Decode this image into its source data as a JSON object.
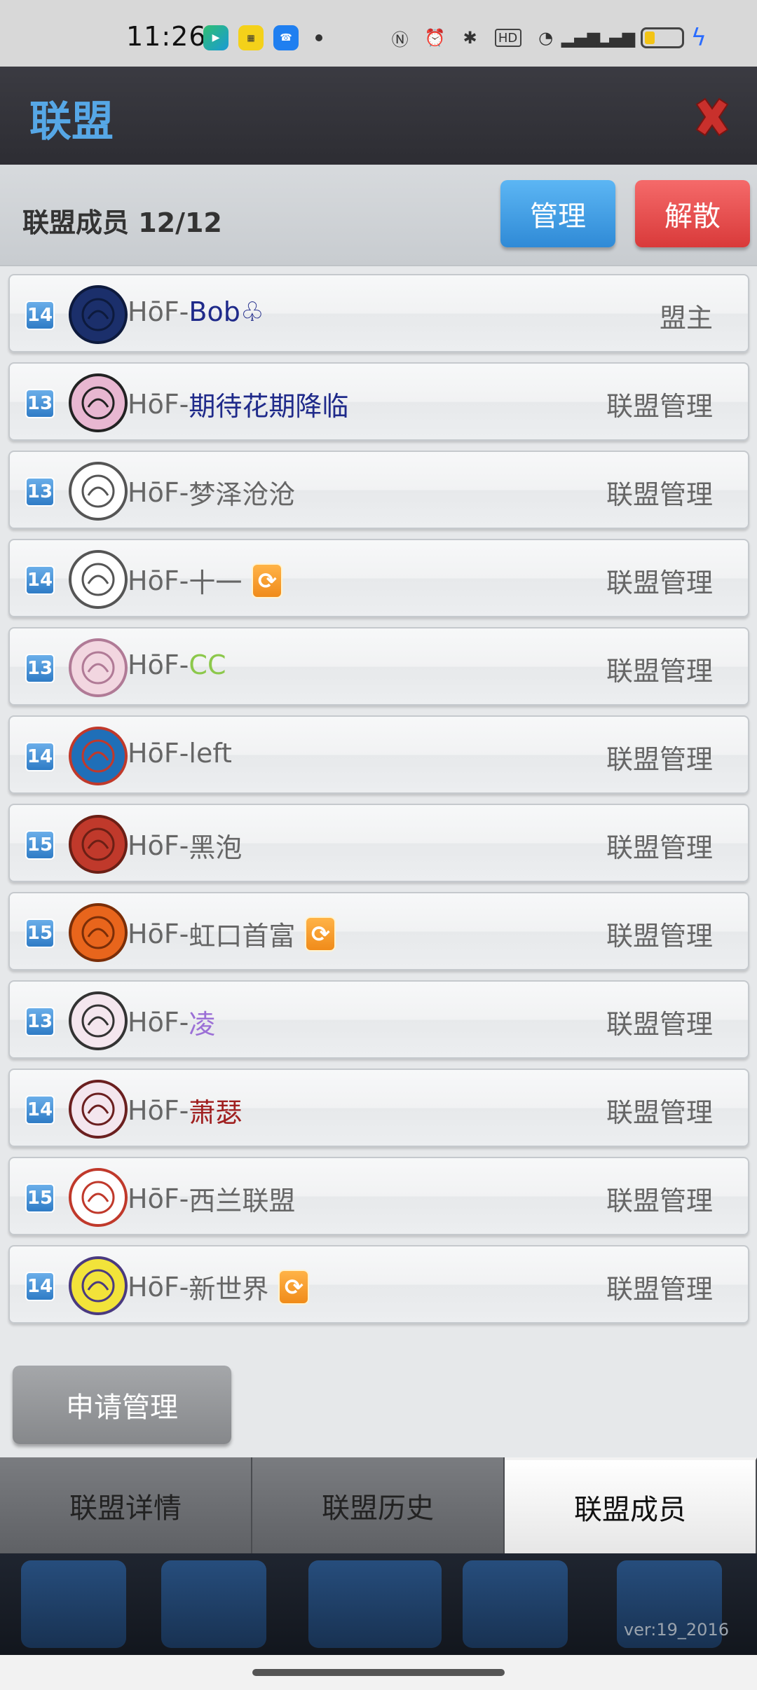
{
  "status_bar": {
    "time": "11:26",
    "icons": [
      "nfc-icon",
      "alarm-icon",
      "bluetooth-icon",
      "hd-icon",
      "wifi-icon",
      "signal-4g-icon",
      "signal-4g-icon",
      "battery-icon",
      "charging-icon"
    ]
  },
  "header": {
    "title": "联盟"
  },
  "members_bar": {
    "count_label": "联盟成员 12/12",
    "manage_label": "管理",
    "disband_label": "解散"
  },
  "members": [
    {
      "level": "14",
      "prefix": "HōF-",
      "nick": "Bob♧",
      "nick_color": "#1f2a8a",
      "role": "盟主",
      "swap": false
    },
    {
      "level": "13",
      "prefix": "HōF-",
      "nick": "期待花期降临",
      "nick_color": "#1f2a8a",
      "role": "联盟管理",
      "swap": false
    },
    {
      "level": "13",
      "prefix": "HōF-",
      "nick": "梦泽沧沧",
      "nick_color": "#666666",
      "role": "联盟管理",
      "swap": false
    },
    {
      "level": "14",
      "prefix": "HōF-",
      "nick": "十一",
      "nick_color": "#666666",
      "role": "联盟管理",
      "swap": true
    },
    {
      "level": "13",
      "prefix": "HōF-",
      "nick": "CC",
      "nick_color": "#8cc84b",
      "role": "联盟管理",
      "swap": false
    },
    {
      "level": "14",
      "prefix": "HōF-",
      "nick": "left",
      "nick_color": "#666666",
      "role": "联盟管理",
      "swap": false
    },
    {
      "level": "15",
      "prefix": "HōF-",
      "nick": "黑泡",
      "nick_color": "#666666",
      "role": "联盟管理",
      "swap": false
    },
    {
      "level": "15",
      "prefix": "HōF-",
      "nick": "虹口首富",
      "nick_color": "#666666",
      "role": "联盟管理",
      "swap": true
    },
    {
      "level": "13",
      "prefix": "HōF-",
      "nick": "凌",
      "nick_color": "#9b6fd6",
      "role": "联盟管理",
      "swap": false
    },
    {
      "level": "14",
      "prefix": "HōF-",
      "nick": "萧瑟",
      "nick_color": "#a02020",
      "role": "联盟管理",
      "swap": false
    },
    {
      "level": "15",
      "prefix": "HōF-",
      "nick": "西兰联盟",
      "nick_color": "#666666",
      "role": "联盟管理",
      "swap": false
    },
    {
      "level": "14",
      "prefix": "HōF-",
      "nick": "新世界",
      "nick_color": "#666666",
      "role": "联盟管理",
      "swap": true
    }
  ],
  "apply_label": "申请管理",
  "tabs": [
    {
      "label": "联盟详情",
      "active": false
    },
    {
      "label": "联盟历史",
      "active": false
    },
    {
      "label": "联盟成员",
      "active": true
    }
  ],
  "version": "ver:19_2016",
  "colors": {
    "title_blue": "#56a7e6",
    "manage_blue": "#2f8ad6",
    "disband_red": "#d93a3a",
    "level_badge": "#2f7cc6",
    "swap_orange": "#f08b1a"
  }
}
